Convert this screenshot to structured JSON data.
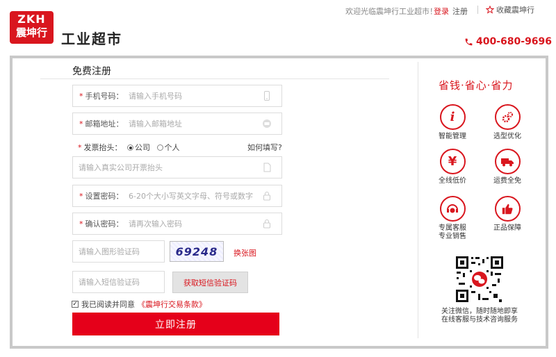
{
  "header": {
    "logo_line1": "ZKH",
    "logo_line2": "震坤行",
    "site_title": "工业超市",
    "welcome": "欢迎光临震坤行工业超市！",
    "login": "登录",
    "register": "注册",
    "favorite": "收藏震坤行",
    "phone": "400-680-9696"
  },
  "form": {
    "title": "免费注册",
    "phone_label": "手机号码：",
    "phone_placeholder": "请输入手机号码",
    "email_label": "邮箱地址：",
    "email_placeholder": "请输入邮箱地址",
    "invoice_label": "发票抬头：",
    "invoice_option_company": "公司",
    "invoice_option_personal": "个人",
    "invoice_selected": "公司",
    "invoice_help": "如何填写?",
    "invoice_placeholder": "请输入真实公司开票抬头",
    "password_label": "设置密码：",
    "password_placeholder": "6-20个大小写英文字母、符号或数字",
    "confirm_label": "确认密码：",
    "confirm_placeholder": "请再次输入密码",
    "captcha_placeholder": "请输入图形验证码",
    "captcha_value": "69248",
    "change_image": "换张图",
    "sms_placeholder": "请输入短信验证码",
    "sms_button": "获取短信验证码",
    "agree_text": "我已阅读并同意",
    "agree_checked": true,
    "terms_link": "《震坤行交易条款》",
    "submit": "立即注册"
  },
  "side": {
    "slogan": "省钱·省心·省力",
    "features": [
      {
        "icon": "info-icon",
        "label": "智能管理"
      },
      {
        "icon": "gears-icon",
        "label": "选型优化"
      },
      {
        "icon": "yen-icon",
        "label": "全线低价"
      },
      {
        "icon": "truck-icon",
        "label": "运费全免"
      },
      {
        "icon": "headset-icon",
        "label": "专属客服",
        "label2": "专业销售"
      },
      {
        "icon": "thumbs-up-icon",
        "label": "正品保障"
      }
    ],
    "qr_caption1": "关注微信，随时随地即享",
    "qr_caption2": "在线客服与技术咨询服务"
  },
  "colors": {
    "brand_red": "#d9161e",
    "button_red": "#e5001a",
    "frame_gray": "#c9c9c9"
  }
}
